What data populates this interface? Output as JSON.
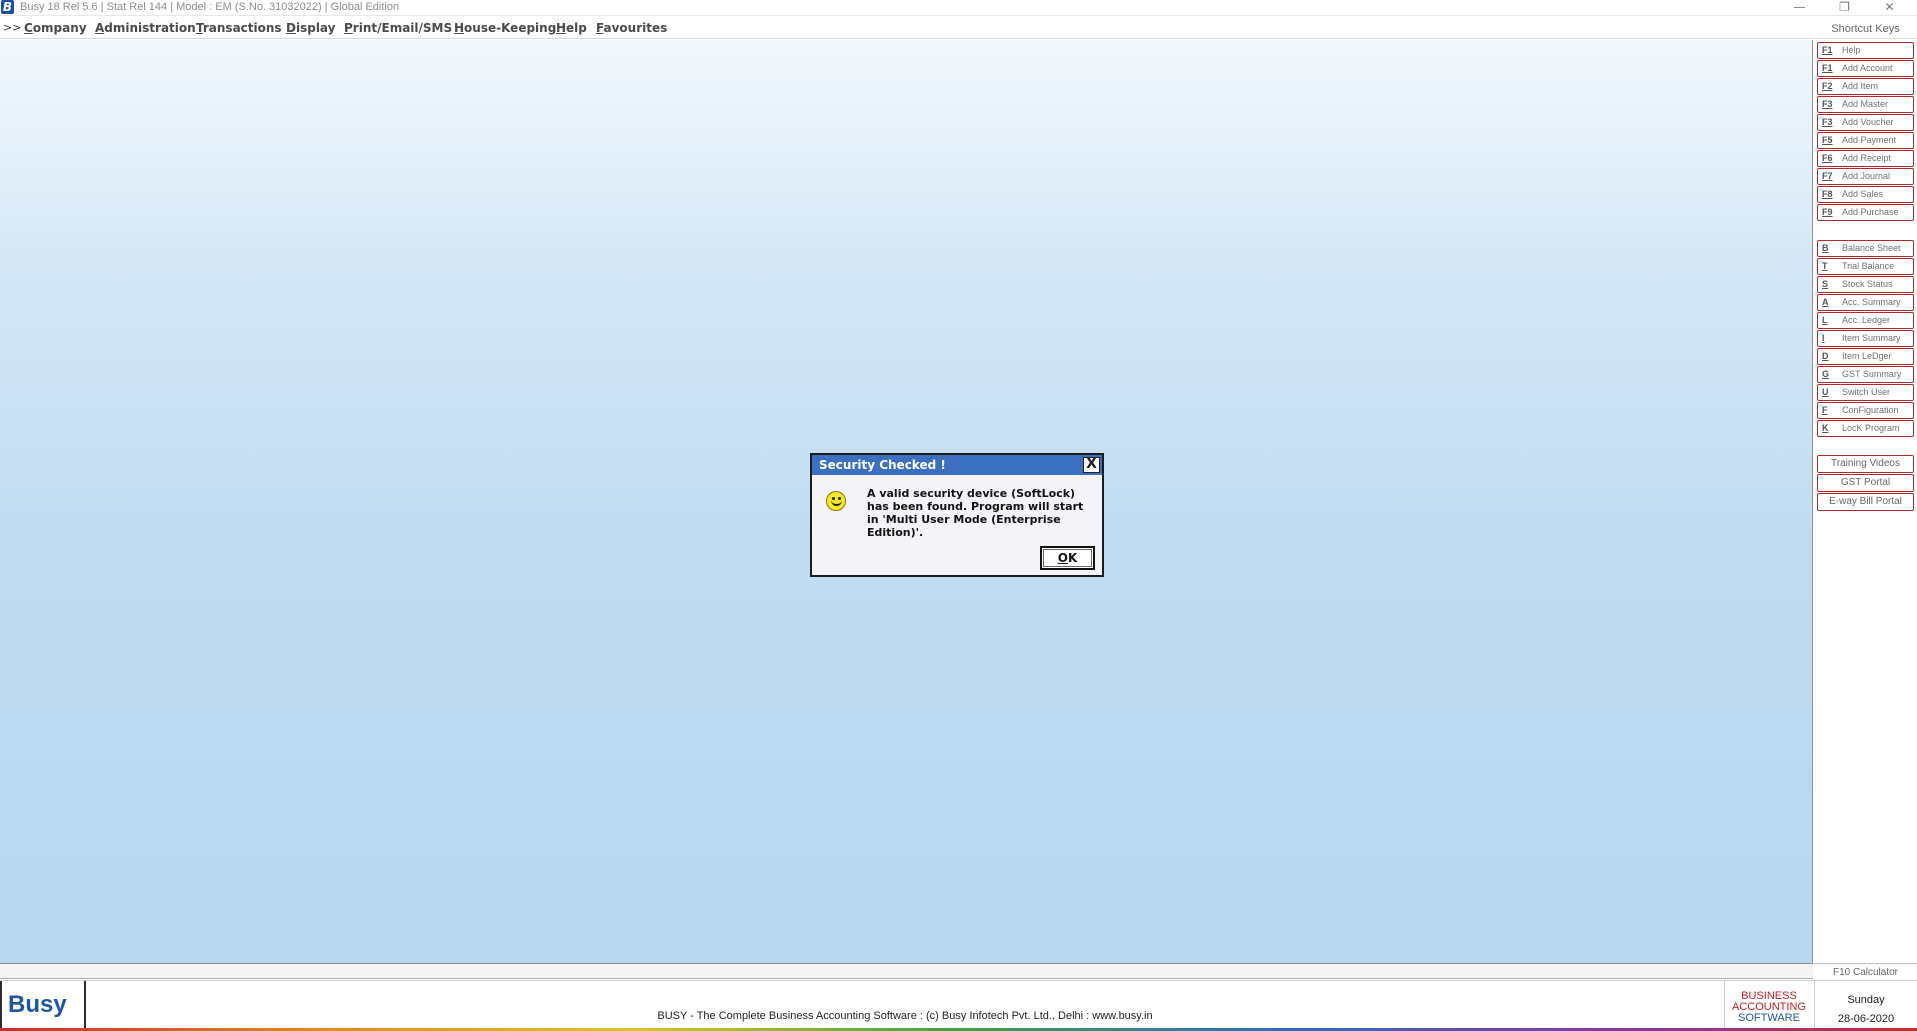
{
  "titlebar": {
    "icon_letter": "B",
    "title": "Busy 18  Rel 5.6  |  Stat Rel 144  |  Model : EM (S.No. 31032022)  |  Global Edition",
    "minimize": "—",
    "restore": "❐",
    "close": "✕"
  },
  "menu": {
    "arrow": ">>",
    "items": [
      {
        "underline": "C",
        "rest": "ompany"
      },
      {
        "underline": "A",
        "rest": "dministration"
      },
      {
        "underline": "T",
        "rest": "ransactions"
      },
      {
        "underline": "D",
        "rest": "isplay"
      },
      {
        "underline": "P",
        "rest": "rint/Email/SMS"
      },
      {
        "underline": "H",
        "rest": "ouse-Keeping"
      },
      {
        "underline": "H",
        "rest": "elp"
      },
      {
        "underline": "F",
        "rest": "avourites"
      }
    ]
  },
  "dialog": {
    "title": "Security Checked !",
    "close_label": "X",
    "icon": "smiley-icon",
    "message": "A valid security device (SoftLock) has been found. Program will start in 'Multi User Mode (Enterprise Edition)'.",
    "ok_underline": "O",
    "ok_rest": "K"
  },
  "shortcuts": {
    "header": "Shortcut Keys",
    "group1": [
      {
        "key": "F1",
        "label": "Help"
      },
      {
        "key": "F1",
        "label": "Add Account"
      },
      {
        "key": "F2",
        "label": "Add Item"
      },
      {
        "key": "F3",
        "label": "Add Master"
      },
      {
        "key": "F3",
        "label": "Add Voucher"
      },
      {
        "key": "F5",
        "label": "Add Payment"
      },
      {
        "key": "F6",
        "label": "Add Receipt"
      },
      {
        "key": "F7",
        "label": "Add Journal"
      },
      {
        "key": "F8",
        "label": "Add Sales"
      },
      {
        "key": "F9",
        "label": "Add Purchase"
      }
    ],
    "group2": [
      {
        "key": "B",
        "label": "Balance Sheet"
      },
      {
        "key": "T",
        "label": "Trial Balance"
      },
      {
        "key": "S",
        "label": "Stock Status"
      },
      {
        "key": "A",
        "label": "Acc. Summary"
      },
      {
        "key": "L",
        "label": "Acc. Ledger"
      },
      {
        "key": "I",
        "label": "Item Summary"
      },
      {
        "key": "D",
        "label": "Item LeDger"
      },
      {
        "key": "G",
        "label": "GST Summary"
      },
      {
        "key": "U",
        "label": "Switch User"
      },
      {
        "key": "F",
        "label": "ConFiguration"
      },
      {
        "key": "K",
        "label": "LocK Program"
      }
    ],
    "links": [
      "Training Videos",
      "GST Portal",
      "E-way Bill Portal"
    ],
    "calculator": "F10 Calculator"
  },
  "footer": {
    "logo": "Busy",
    "text": "BUSY - The Complete Business Accounting Software  :  (c) Busy Infotech Pvt. Ltd., Delhi  :  www.busy.in",
    "brand_line1": "BUSINESS",
    "brand_line2": "ACCOUNTING",
    "brand_line3": "SOFTWARE",
    "day": "Sunday",
    "date": "28-06-2020"
  },
  "colors": {
    "accent": "#3b6fc0",
    "shortcut_border": "#b22828",
    "brand_blue": "#1d56a5",
    "brand_red": "#c42020"
  }
}
